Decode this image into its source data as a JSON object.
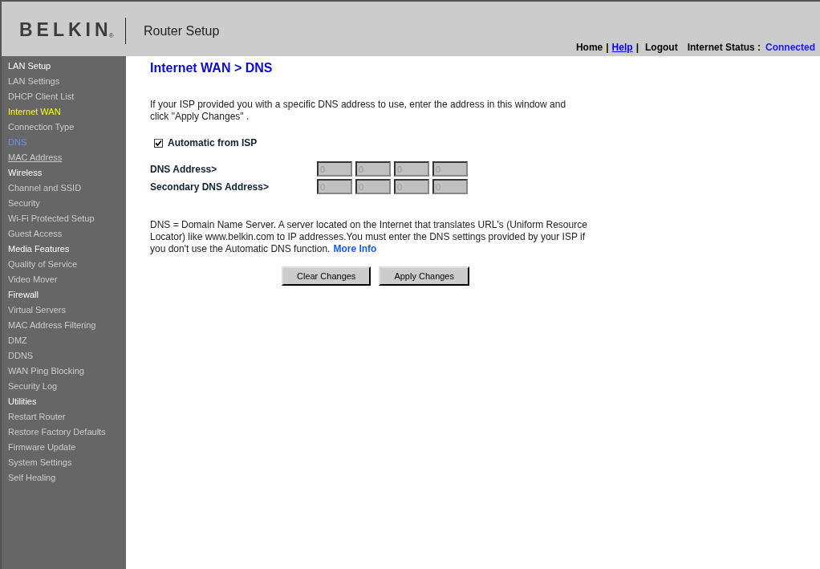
{
  "header": {
    "logo": "BELKIN",
    "logo_mark": "®",
    "title": "Router Setup",
    "links": [
      {
        "label": "Home",
        "kind": "plain"
      },
      {
        "label": "Help",
        "kind": "link"
      },
      {
        "label": "Logout",
        "kind": "plain"
      }
    ],
    "separator": "|",
    "status_label": "Internet Status :",
    "status_value": "Connected"
  },
  "sidebar": {
    "items": [
      {
        "label": "LAN Setup",
        "kind": "section",
        "selected": false
      },
      {
        "label": "LAN Settings",
        "kind": "item",
        "selected": false
      },
      {
        "label": "DHCP Client List",
        "kind": "item",
        "selected": false
      },
      {
        "label": "Internet WAN",
        "kind": "section",
        "selected": true
      },
      {
        "label": "Connection Type",
        "kind": "item",
        "selected": false
      },
      {
        "label": "DNS",
        "kind": "item",
        "selected": true
      },
      {
        "label": "MAC Address",
        "kind": "item",
        "selected": false,
        "hovered": true
      },
      {
        "label": "Wireless",
        "kind": "section",
        "selected": false
      },
      {
        "label": "Channel and SSID",
        "kind": "item",
        "selected": false
      },
      {
        "label": "Security",
        "kind": "item",
        "selected": false
      },
      {
        "label": "Wi-Fi Protected Setup",
        "kind": "item",
        "selected": false
      },
      {
        "label": "Guest Access",
        "kind": "item",
        "selected": false
      },
      {
        "label": "Media Features",
        "kind": "section",
        "selected": false
      },
      {
        "label": "Quality of Service",
        "kind": "item",
        "selected": false
      },
      {
        "label": "Video Mover",
        "kind": "item",
        "selected": false
      },
      {
        "label": "Firewall",
        "kind": "section",
        "selected": false
      },
      {
        "label": "Virtual Servers",
        "kind": "item",
        "selected": false
      },
      {
        "label": "MAC Address Filtering",
        "kind": "item",
        "selected": false
      },
      {
        "label": "DMZ",
        "kind": "item",
        "selected": false
      },
      {
        "label": "DDNS",
        "kind": "item",
        "selected": false
      },
      {
        "label": "WAN Ping Blocking",
        "kind": "item",
        "selected": false
      },
      {
        "label": "Security Log",
        "kind": "item",
        "selected": false
      },
      {
        "label": "Utilities",
        "kind": "section",
        "selected": false
      },
      {
        "label": "Restart Router",
        "kind": "item",
        "selected": false
      },
      {
        "label": "Restore Factory Defaults",
        "kind": "item",
        "selected": false
      },
      {
        "label": "Firmware Update",
        "kind": "item",
        "selected": false
      },
      {
        "label": "System Settings",
        "kind": "item",
        "selected": false
      },
      {
        "label": "Self Healing",
        "kind": "item",
        "selected": false
      }
    ]
  },
  "content": {
    "heading": "Internet WAN > DNS",
    "intro": "If your ISP provided you with a specific DNS address to use, enter the address in this window and click \"Apply Changes\" .",
    "automatic": {
      "label": "Automatic from ISP",
      "checked": true
    },
    "addresses": [
      {
        "label": "DNS Address>",
        "octets": [
          "0",
          "0",
          "0",
          "0"
        ],
        "disabled": true
      },
      {
        "label": "Secondary DNS Address>",
        "octets": [
          "0",
          "0",
          "0",
          "0"
        ],
        "disabled": true
      }
    ],
    "note": "DNS = Domain Name Server. A server located on the Internet that translates URL's (Uniform Resource Locator) like www.belkin.com to IP addresses.You must enter the DNS settings provided by your ISP if you don't use the Automatic DNS function.",
    "more_info": "More Info",
    "buttons": [
      "Clear Changes",
      "Apply Changes"
    ]
  }
}
